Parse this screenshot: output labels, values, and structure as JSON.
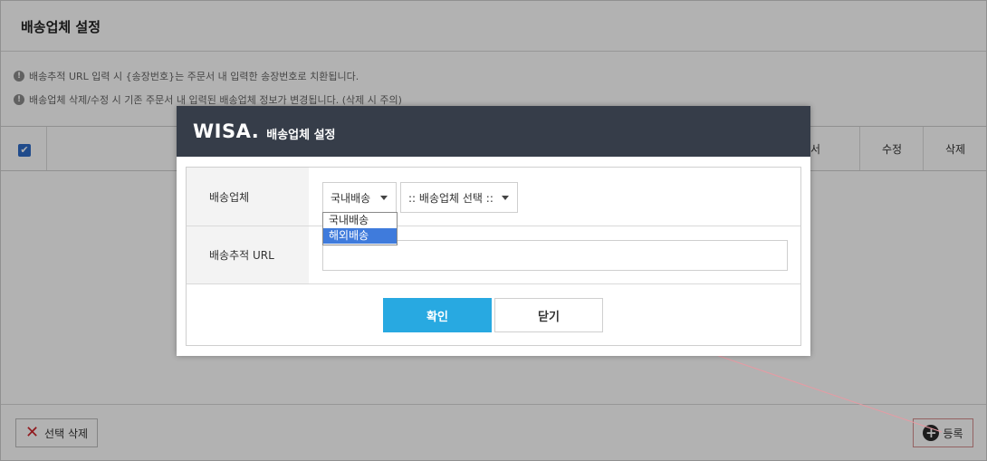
{
  "page": {
    "title": "배송업체 설정",
    "notices": [
      "배송추적 URL 입력 시 {송장번호}는 주문서 내 입력한 송장번호로 치환됩니다.",
      "배송업체 삭제/수정 시 기존 주문서 내 입력된 배송업체 정보가 변경됩니다. (삭제 시 주의)"
    ],
    "table": {
      "columns": [
        "순서",
        "수정",
        "삭제"
      ],
      "select_all_checked": true
    },
    "delete_selected_label": "선택 삭제",
    "register_label": "등록"
  },
  "modal": {
    "logo": "WISA.",
    "title": "배송업체 설정",
    "rows": {
      "carrier_label": "배송업체",
      "url_label": "배송추적 URL"
    },
    "shipping_type": {
      "selected": "국내배송",
      "options": [
        "국내배송",
        "해외배송"
      ],
      "highlighted": "해외배송"
    },
    "carrier_select": {
      "selected": ":: 배송업체 선택 ::"
    },
    "url_input": {
      "value": "",
      "placeholder": ""
    },
    "confirm_label": "확인",
    "close_label": "닫기"
  },
  "colors": {
    "header_bg": "#363d49",
    "confirm_bg": "#28a9e1",
    "highlight": "#3f7bdc",
    "checkbox": "#2f6cc8",
    "delete_x": "#d0262c"
  }
}
